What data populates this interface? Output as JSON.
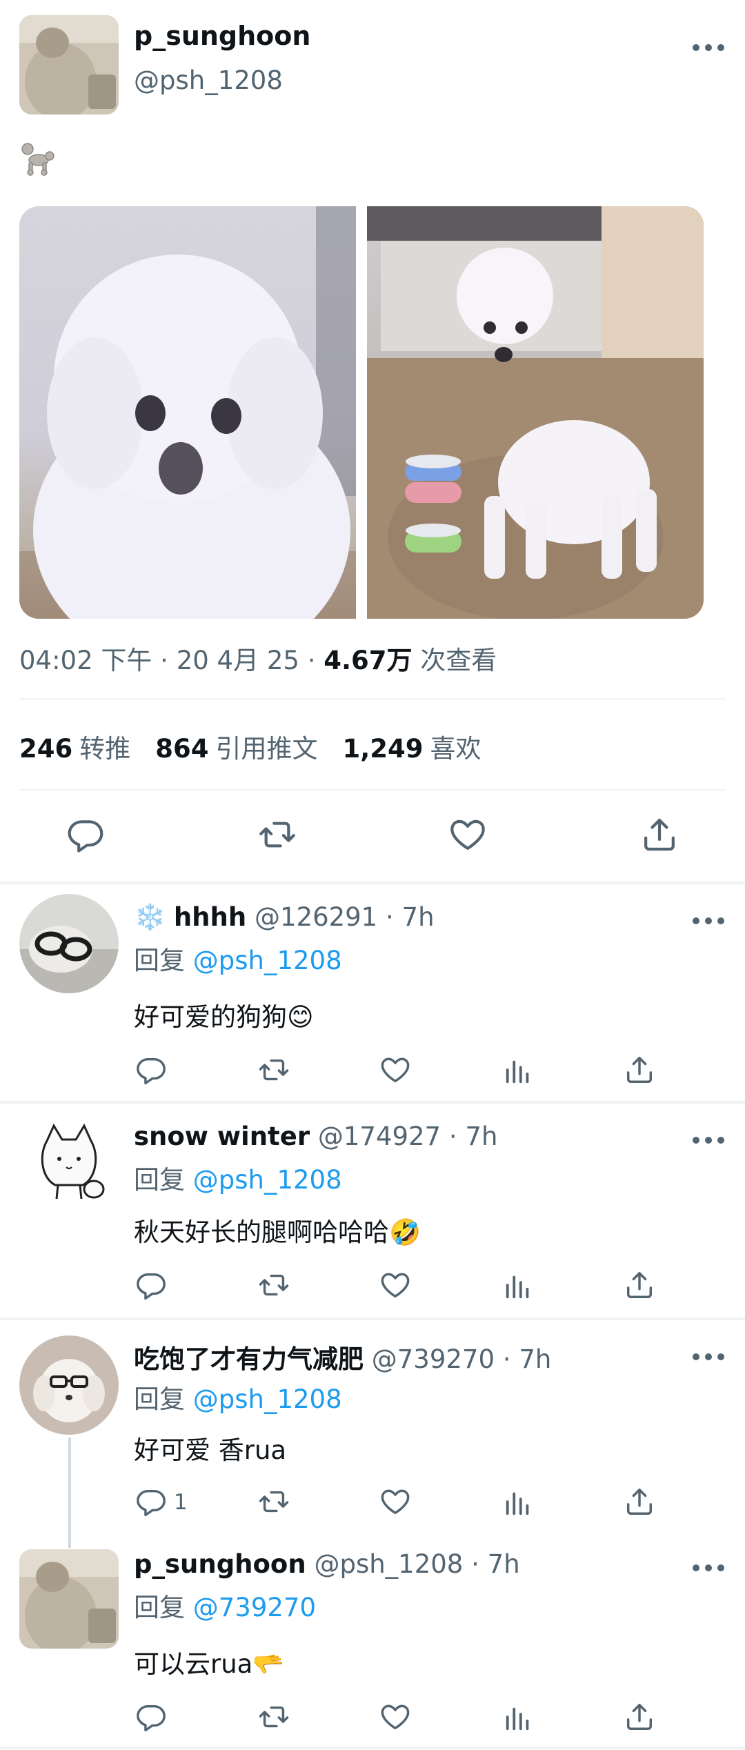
{
  "tweet": {
    "author_name": "p_sunghoon",
    "author_handle": "@psh_1208",
    "text_emoji": "🐩",
    "time": "04:02 下午",
    "date": "20 4月 25",
    "views_count": "4.67万",
    "views_label": "次查看",
    "retweets_count": "246",
    "retweets_label": "转推",
    "quotes_count": "864",
    "quotes_label": "引用推文",
    "likes_count": "1,249",
    "likes_label": "喜欢"
  },
  "replies": [
    {
      "name_prefix": "❄️",
      "name": "hhhh",
      "handle": "@126291",
      "time": "7h",
      "reply_label": "回复",
      "reply_to": "@psh_1208",
      "text": "好可爱的狗狗😊",
      "reply_count": ""
    },
    {
      "name": "snow winter",
      "handle": "@174927",
      "time": "7h",
      "reply_label": "回复",
      "reply_to": "@psh_1208",
      "text": "秋天好长的腿啊哈哈哈🤣",
      "reply_count": ""
    },
    {
      "name": "吃饱了才有力气减肥",
      "handle": "@739270",
      "time": "7h",
      "reply_label": "回复",
      "reply_to": "@psh_1208",
      "text": "好可爱 香rua",
      "reply_count": "1"
    },
    {
      "name": "p_sunghoon",
      "handle": "@psh_1208",
      "time": "7h",
      "reply_label": "回复",
      "reply_to": "@739270",
      "text": "可以云rua🫳",
      "reply_count": ""
    }
  ],
  "colors": {
    "link": "#1d9bf0",
    "secondary_text": "#536471",
    "primary_text": "#0f1419",
    "divider": "#eff3f4"
  },
  "icons": [
    "more-icon",
    "reply-icon",
    "retweet-icon",
    "like-icon",
    "views-icon",
    "share-icon"
  ]
}
